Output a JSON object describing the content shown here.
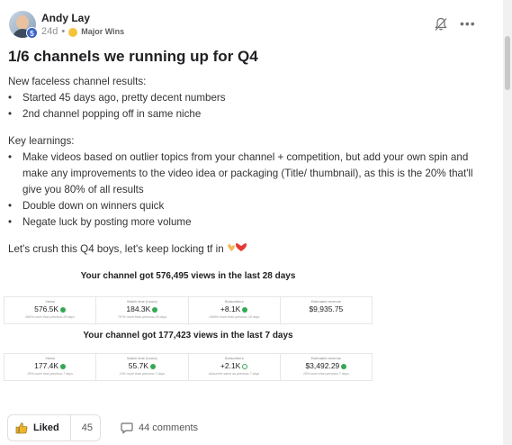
{
  "post": {
    "author": "Andy Lay",
    "level": "5",
    "time": "24d",
    "meta_separator": "•",
    "category": "Major Wins",
    "title": "1/6 channels we running up for Q4",
    "intro": "New faceless channel results:",
    "results": [
      "Started 45 days ago, pretty decent numbers",
      "2nd channel popping off in same niche"
    ],
    "learnings_heading": "Key learnings:",
    "learnings": [
      "Make videos based on outlier topics from your channel + competition, but add your own spin and make any improvements to the video idea or packaging (Title/ thumbnail), as this is the 20% that'll give you 80% of all results",
      "Double down on winners quick",
      "Negate luck by posting more volume"
    ],
    "closing": "Let's crush this Q4 boys, let's keep locking tf in"
  },
  "stats": {
    "period_28": {
      "heading": "Your channel got 576,495 views in the last 28 days",
      "cards": [
        {
          "label": "Views",
          "value": "576.5K",
          "trend": "up",
          "note": "566% more than previous 28 days"
        },
        {
          "label": "Watch time (hours)",
          "value": "184.3K",
          "trend": "up",
          "note": "797% more than previous 28 days"
        },
        {
          "label": "Subscribers",
          "value": "+8.1K",
          "trend": "up",
          "note": ">999% more than previous 28 days"
        },
        {
          "label": "Estimated revenue",
          "value": "$9,935.75",
          "trend": "",
          "note": ""
        }
      ]
    },
    "period_7": {
      "heading": "Your channel got 177,423 views in the last 7 days",
      "cards": [
        {
          "label": "Views",
          "value": "177.4K",
          "trend": "up",
          "note": "35% more than previous 7 days"
        },
        {
          "label": "Watch time (hours)",
          "value": "55.7K",
          "trend": "up",
          "note": "24% more than previous 7 days"
        },
        {
          "label": "Subscribers",
          "value": "+2.1K",
          "trend": "neutral",
          "note": "About the same as previous 7 days"
        },
        {
          "label": "Estimated revenue",
          "value": "$3,492.29",
          "trend": "up",
          "note": "28% more than previous 7 days"
        }
      ]
    }
  },
  "footer": {
    "like_label": "Liked",
    "like_count": "45",
    "comments_label": "44 comments"
  },
  "colors": {
    "accent_blue": "#3b63c4",
    "trend_green": "#34a853"
  }
}
